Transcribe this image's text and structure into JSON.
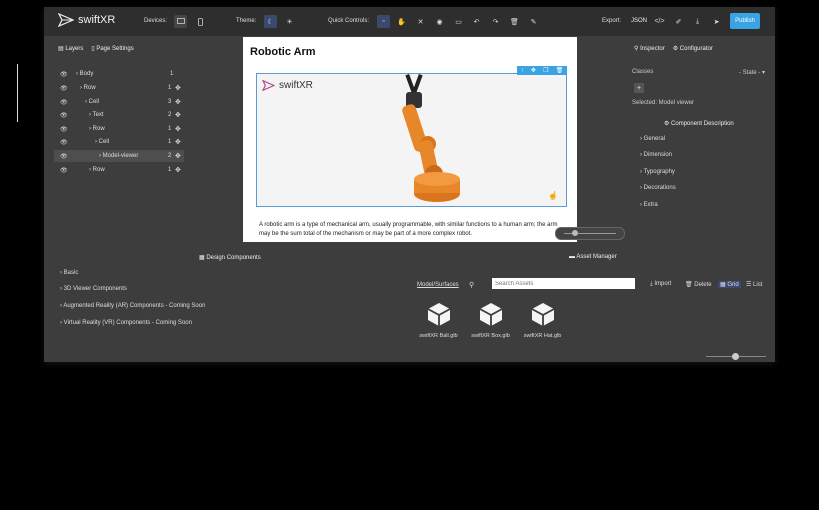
{
  "topbar": {
    "app_name": "swiftXR",
    "devices_label": "Devices:",
    "theme_label": "Theme:",
    "quick_controls_label": "Quick Controls:",
    "export_label": "Export:",
    "json_label": "JSON",
    "publish_label": "Publish"
  },
  "left": {
    "tab_layers": "Layers",
    "tab_page_settings": "Page Settings",
    "layers": [
      {
        "name": "Body",
        "count": "1"
      },
      {
        "name": "Row",
        "count": "1"
      },
      {
        "name": "Cell",
        "count": "3"
      },
      {
        "name": "Text",
        "count": "2"
      },
      {
        "name": "Row",
        "count": "1"
      },
      {
        "name": "Cell",
        "count": "1"
      },
      {
        "name": "Model-viewer",
        "count": "2"
      },
      {
        "name": "Row",
        "count": "1"
      }
    ]
  },
  "canvas": {
    "title": "Robotic Arm",
    "viewer_brand": "swiftXR",
    "paragraph": "A robotic arm is a type of mechanical arm, usually programmable, with similar functions to a human arm; the arm may be the sum total of the mechanism or may be part of a more complex robot."
  },
  "right": {
    "tab_inspector": "Inspector",
    "tab_configurator": "Configurator",
    "classes_label": "Classes",
    "state_label": "- State -",
    "selected_label": "Selected: Model viewer",
    "component_description": "Component Description",
    "sections": [
      "General",
      "Dimension",
      "Typography",
      "Decorations",
      "Extra"
    ]
  },
  "bottom": {
    "design_components_title": "Design Components",
    "components": [
      "Basic",
      "3D Viewer Components",
      "Augmented Reality (AR) Components - Coming Soon",
      "Virtual Reality (VR) Components - Coming Soon"
    ],
    "asset_manager_title": "Asset Manager",
    "search_label": "Model/Surfaces",
    "search_placeholder": "Search Assets",
    "import_label": "Import",
    "delete_label": "Delete",
    "grid_label": "Grid",
    "list_label": "List",
    "assets": [
      "swiftXR Ball.glb",
      "swiftXR Box.glb",
      "swiftXR Hat.glb"
    ]
  }
}
